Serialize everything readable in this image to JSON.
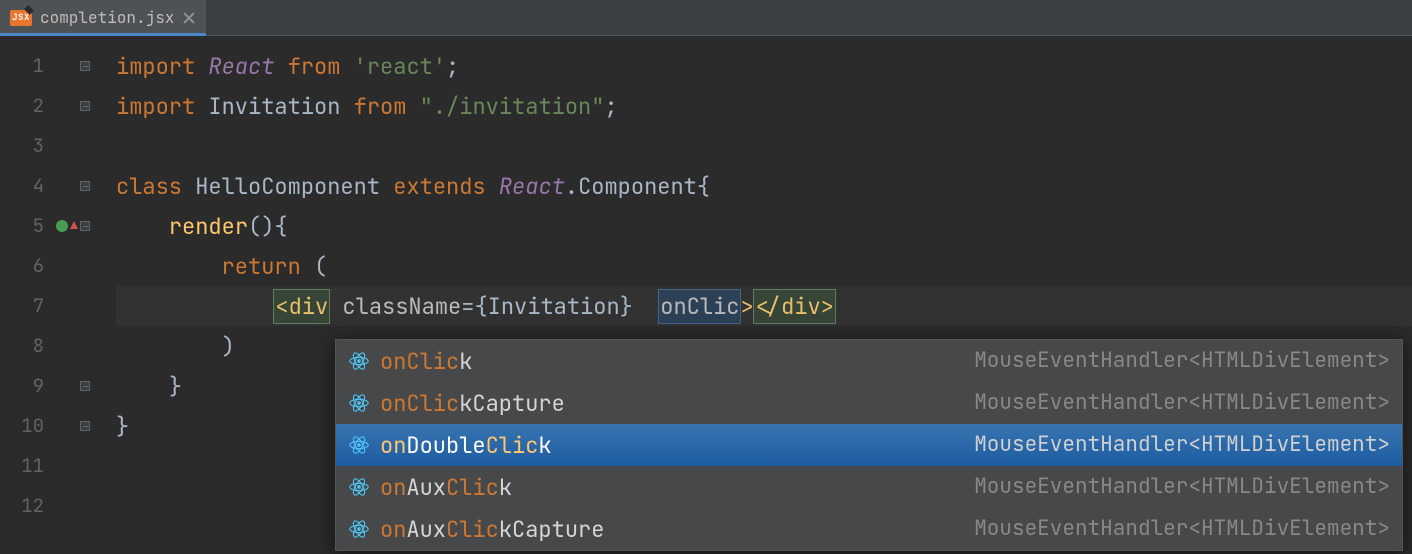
{
  "tab": {
    "filename": "completion.jsx",
    "icon_label": "JSX"
  },
  "gutter": {
    "lines": [
      "1",
      "2",
      "3",
      "4",
      "5",
      "6",
      "7",
      "8",
      "9",
      "10",
      "11",
      "12"
    ]
  },
  "code": {
    "l1": {
      "import": "import",
      "React": "React",
      "from": "from",
      "react": "'react'",
      "semi": ";"
    },
    "l2": {
      "import": "import",
      "Invitation": "Invitation",
      "from": "from",
      "path": "\"./invitation\"",
      "semi": ";"
    },
    "l4": {
      "class": "class",
      "name": "HelloComponent",
      "extends": "extends",
      "React": "React",
      "dot": ".",
      "Component": "Component",
      "brace": "{"
    },
    "l5": {
      "indent": "    ",
      "render": "render",
      "paren": "()",
      "brace": "{"
    },
    "l6": {
      "indent": "        ",
      "return": "return",
      "paren": " ("
    },
    "l7": {
      "indent": "            ",
      "open": "<",
      "div": "div",
      "sp": " ",
      "className": "className",
      "eq": "=",
      "lb": "{",
      "Invitation": "Invitation",
      "rb": "}",
      "sp2": "  ",
      "onClic": "onClic",
      "gt": ">",
      "close": "</div>"
    },
    "l8": {
      "indent": "        ",
      "paren": ")"
    },
    "l9": {
      "indent": "    ",
      "brace": "}"
    },
    "l10": {
      "brace": "}"
    }
  },
  "completion": {
    "items": [
      {
        "match": "onClic",
        "rest": "k",
        "type": "MouseEventHandler<HTMLDivElement>"
      },
      {
        "match": "onClic",
        "rest": "kCapture",
        "type": "MouseEventHandler<HTMLDivElement>"
      },
      {
        "pre": "on",
        "mid": "DoubleClic",
        "rest": "k",
        "match_parts": true,
        "type": "MouseEventHandler<HTMLDivElement>"
      },
      {
        "pre": "on",
        "mid": "AuxClic",
        "rest": "k",
        "match_parts": true,
        "type": "MouseEventHandler<HTMLDivElement>"
      },
      {
        "pre": "on",
        "mid": "AuxClic",
        "rest": "kCapture",
        "match_parts": true,
        "type": "MouseEventHandler<HTMLDivElement>"
      }
    ],
    "selected_index": 2
  }
}
